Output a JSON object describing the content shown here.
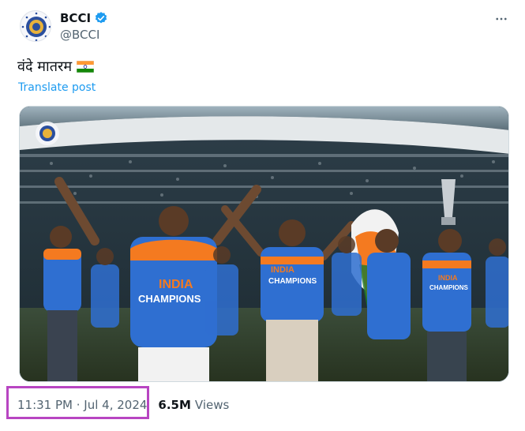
{
  "post": {
    "author": {
      "display_name": "BCCI",
      "handle": "@BCCI",
      "verified": true,
      "avatar_icon": "bcci-logo-icon"
    },
    "text": "वंदे मातरम",
    "flag_icon": "india-flag-icon",
    "translate_label": "Translate post",
    "media": {
      "kind": "photo",
      "jersey_text_line1": "INDIA",
      "jersey_text_line2": "CHAMPIONS"
    },
    "timestamp": "11:31 PM · Jul 4, 2024",
    "views_count": "6.5M",
    "views_label": "Views"
  },
  "colors": {
    "link": "#1d9bf0",
    "secondary_text": "#536471",
    "highlight": "#b845c2",
    "jersey_blue": "#2f6fd1",
    "jersey_orange": "#f47a20"
  }
}
